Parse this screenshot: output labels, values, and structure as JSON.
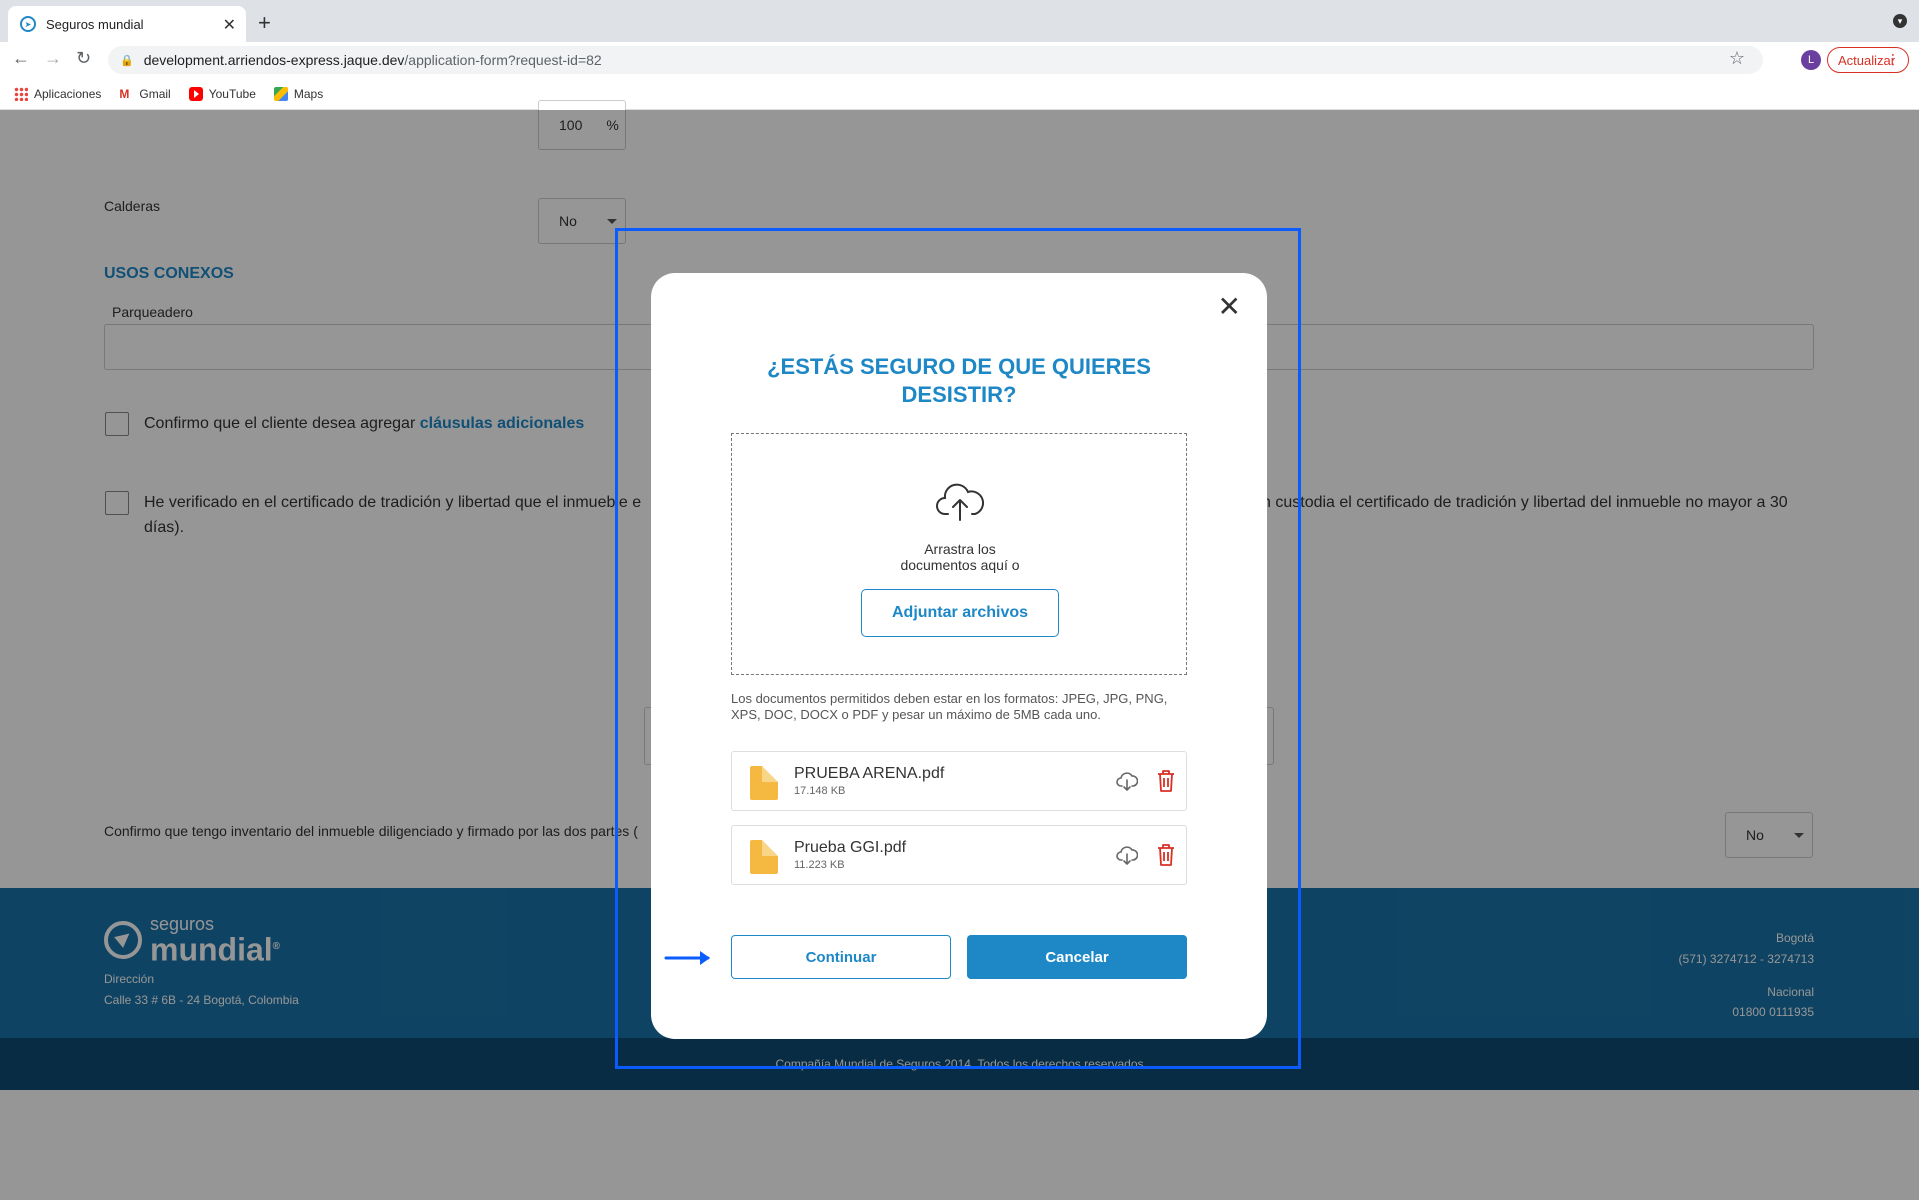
{
  "browser": {
    "tab_title": "Seguros mundial",
    "url_host": "development.arriendos-express.jaque.dev",
    "url_path": "/application-form?request-id=82",
    "profile_initial": "L",
    "update_label": "Actualizar",
    "bookmarks": [
      {
        "label": "Aplicaciones",
        "icon": "apps-grid-icon"
      },
      {
        "label": "Gmail",
        "icon": "gmail-icon"
      },
      {
        "label": "YouTube",
        "icon": "youtube-icon"
      },
      {
        "label": "Maps",
        "icon": "maps-icon"
      }
    ]
  },
  "page": {
    "percent_value": "100",
    "percent_unit": "%",
    "calderas_label": "Calderas",
    "calderas_value": "No",
    "section_usos": "USOS CONEXOS",
    "parqueadero_label": "Parqueadero",
    "check1_text": "Confirmo que el cliente desea agregar",
    "check1_link": "cláusulas adicionales",
    "check2_text_left": "He verificado en el certificado de tradición y libertad que el inmueble e",
    "check2_text_right": "n custodia el certificado de tradición y libertad del inmueble no mayor a 30",
    "check2_text_line2": "días).",
    "inventory_text": "Confirmo que tengo inventario del inmueble diligenciado y firmado por las dos partes (",
    "inventory_value": "No"
  },
  "footer": {
    "logo_small": "seguros",
    "logo_big": "mundial",
    "logo_reg": "®",
    "address_label": "Dirección",
    "address_value": "Calle 33 # 6B - 24 Bogotá, Colombia",
    "city_label": "Bogotá",
    "city_phone": "(571) 3274712 - 3274713",
    "national_label": "Nacional",
    "national_phone": "01800 0111935",
    "copyright": "Compañía Mundial de Seguros 2014. Todos los derechos reservados"
  },
  "modal": {
    "title": "¿ESTÁS SEGURO DE QUE QUIERES DESISTIR?",
    "dropzone_text_1": "Arrastra los",
    "dropzone_text_2": "documentos aquí o",
    "attach_label": "Adjuntar archivos",
    "formats_text": "Los documentos permitidos deben estar en los formatos: JPEG, JPG, PNG, XPS, DOC, DOCX o PDF y pesar un máximo de 5MB cada uno.",
    "files": [
      {
        "name": "PRUEBA ARENA.pdf",
        "size": "17.148 KB"
      },
      {
        "name": "Prueba GGI.pdf",
        "size": "11.223 KB"
      }
    ],
    "continue_label": "Continuar",
    "cancel_label": "Cancelar"
  },
  "colors": {
    "accent": "#1e88c7",
    "highlight": "#0a5cff",
    "delete": "#d93025",
    "file_icon": "#f5b942"
  }
}
